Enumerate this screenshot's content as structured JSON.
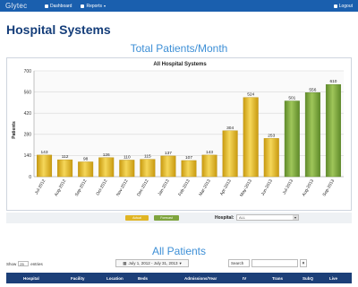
{
  "nav": {
    "logo": "Glytec",
    "dashboard": "Dashboard",
    "reports": "Reports",
    "logout": "Logout"
  },
  "page_title": "Hospital Systems",
  "chart_section_title": "Total Patients/Month",
  "chart_data": {
    "type": "bar",
    "title": "All Hospital Systems",
    "ylabel": "Patients",
    "xlabel": "",
    "ylim": [
      0,
      700
    ],
    "yticks": [
      0,
      140,
      280,
      420,
      560,
      700
    ],
    "grid": true,
    "categories": [
      "Jul-2012",
      "Aug-2012",
      "Sep-2012",
      "Oct-2012",
      "Nov-2012",
      "Dec-2012",
      "Jan-2013",
      "Feb-2013",
      "Mar-2013",
      "Apr-2013",
      "May-2013",
      "Jun-2013",
      "Jul-2013",
      "Aug-2013",
      "Sep-2013"
    ],
    "series": [
      {
        "values": [
          143,
          112,
          98,
          126,
          110,
          115,
          137,
          107,
          143,
          304,
          524,
          253,
          501,
          556,
          610
        ]
      }
    ],
    "bar_kinds": [
      "actual",
      "actual",
      "actual",
      "actual",
      "actual",
      "actual",
      "actual",
      "actual",
      "actual",
      "actual",
      "actual",
      "actual",
      "forecast",
      "forecast",
      "forecast"
    ],
    "colors": {
      "actual": "#e8bf2a",
      "forecast": "#86ad44"
    }
  },
  "filter": {
    "legend_actual": "Actual",
    "legend_forecast": "Forecast",
    "hospital_label": "Hospital:",
    "hospital_value": "ALL"
  },
  "patients_section_title": "All Patients",
  "table_controls": {
    "show_label": "Show",
    "entries_value": "25",
    "entries_label": "entries",
    "date_range": "July 1, 2012 - July 31, 2013",
    "search_label": "Search",
    "clear_label": "×"
  },
  "table": {
    "columns": [
      "Hospital",
      "Facility",
      "Location",
      "Beds",
      "Admissions/Year",
      "IV",
      "Trans",
      "SubQ",
      "Live"
    ]
  }
}
